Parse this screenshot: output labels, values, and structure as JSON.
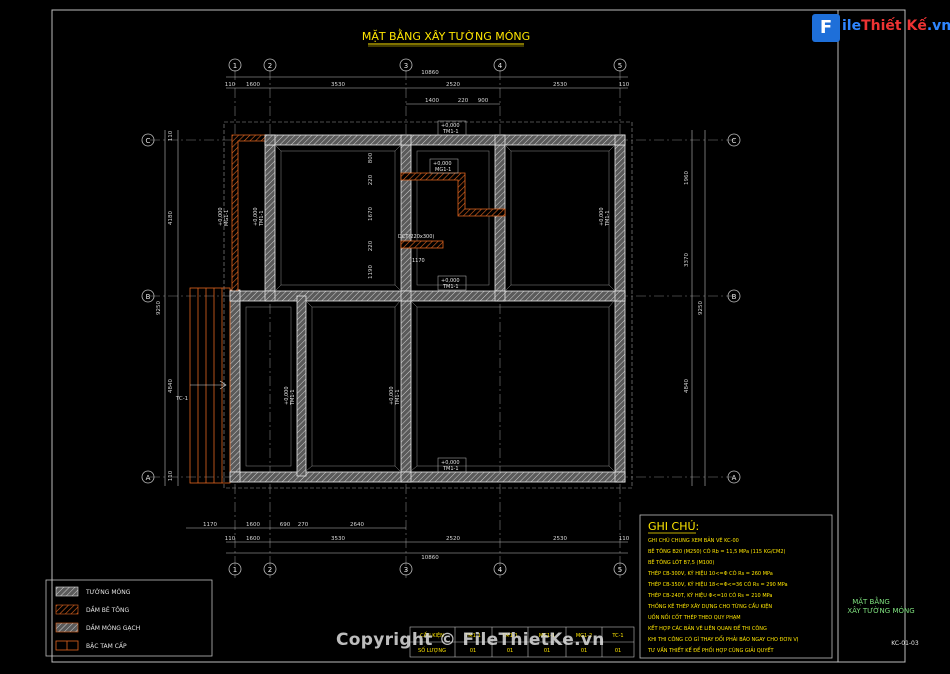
{
  "title": "MẶT BẰNG XÂY TƯỜNG MÓNG",
  "logo": {
    "letter": "F",
    "text_a": "ile",
    "text_b": "Thiết",
    "text_c": "Kế",
    "text_d": ".vn"
  },
  "watermark": "Copyright © FileThietKe.vn",
  "grid_top": [
    "1",
    "2",
    "3",
    "4",
    "5"
  ],
  "grid_left": [
    "C",
    "B",
    "A"
  ],
  "dims_top_total": "10860",
  "dims_top_row": [
    "110",
    "1600",
    "3530",
    "2520",
    "2530",
    "110"
  ],
  "dims_top_inner": [
    "1400",
    "220",
    "900"
  ],
  "dims_bottom_row1": [
    "1170",
    "1600",
    "690",
    "270",
    "2640"
  ],
  "dims_bottom_row2": [
    "110",
    "1600",
    "3530",
    "2520",
    "2530",
    "110"
  ],
  "dims_bottom_total": "10860",
  "dims_left": [
    "110",
    "4180",
    "9250",
    "4840",
    "110"
  ],
  "dims_right": [
    "1960",
    "3370",
    "9250",
    "4840"
  ],
  "dims_inner_v": [
    "800",
    "220",
    "1670",
    "220",
    "1190"
  ],
  "labels_tm": [
    "+0,000",
    "TM1-1"
  ],
  "label_mg": [
    "+0,000",
    "MG1-1"
  ],
  "label_dct": "DCT(220x300)",
  "label_1170": "1170",
  "label_tc": "TC-1",
  "notes_title": "GHI CHÚ:",
  "notes": [
    "GHI CHÚ CHUNG XEM BẢN VẼ KC-00",
    "BÊ TÔNG B20 (M250) CÓ Rb = 11,5 MPa (115 KG/CM2)",
    "BÊ TÔNG LÓT B7,5 (M100)",
    "THÉP CB-300V, KÝ HIỆU 10<=Φ CÓ Rs = 260 MPa",
    "THÉP CB-350V, KÝ HIỆU 18<=Φ<=36 CÓ Rs = 290 MPa",
    "THÉP CB-240T, KÝ HIỆU Φ<=10 CÓ Rs = 210 MPa",
    "THỐNG KÊ THÉP XÂY DỰNG CHO TỪNG CẤU KIỆN",
    "UỐN NỐI CỐT THÉP THEO QUY PHẠM",
    "KẾT HỢP CÁC BẢN VẼ LIÊN QUAN ĐỂ THI CÔNG",
    "KHI THI CÔNG CÓ GÌ THAY ĐỔI PHẢI BÁO NGAY CHO ĐƠN VỊ",
    "TƯ VẤN THIẾT KẾ ĐỂ PHỐI HỢP CÙNG GIẢI QUYẾT"
  ],
  "legend": [
    {
      "label": "TƯỜNG MÓNG",
      "color": "#9a9a9a"
    },
    {
      "label": "DẦM BÊ TÔNG",
      "color": "#e06a2a"
    },
    {
      "label": "DẦM MÓNG GẠCH",
      "color": "#b8b8b8"
    },
    {
      "label": "BẬC TAM CẤP",
      "color": "#e06a2a"
    }
  ],
  "schedule": {
    "header": [
      "CẤU KIỆN",
      "TM1-1",
      "MG1-1",
      "MG1-2",
      "TC-1"
    ],
    "row": [
      "SỐ LƯỢNG",
      "01",
      "01",
      "01",
      "01"
    ]
  },
  "titleblock": {
    "name1": "MẶT BẰNG",
    "name2": "XÂY TƯỜNG MÓNG",
    "code": "KC-01-03"
  },
  "colors": {
    "yellow": "#ffe600",
    "grey": "#c8c8c8",
    "orange": "#e0651f",
    "dim": "#d8d8d8",
    "green": "#7ee07e"
  }
}
